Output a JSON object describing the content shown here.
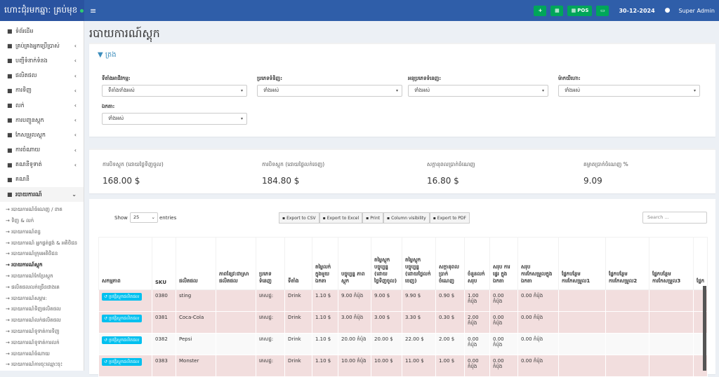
{
  "brand": {
    "title": "ហោះជុំរមកឆ្នា: គ្រប់មុខ"
  },
  "topbar": {
    "calc_icon": "calculator-icon",
    "pos_label": "POS",
    "date": "30-12-2024",
    "user": "Super Admin"
  },
  "sidebar": {
    "items": [
      {
        "label": "ទំព័រដើម",
        "icon": "dashboard-icon",
        "chev": ""
      },
      {
        "label": "គ្រប់គ្រងអ្នកប្រើប្រាស់",
        "icon": "users-icon",
        "chev": "‹"
      },
      {
        "label": "បញ្ជីទំនាក់ទំនង",
        "icon": "contacts-icon",
        "chev": "‹"
      },
      {
        "label": "ផលិតផល",
        "icon": "cubes-icon",
        "chev": "‹"
      },
      {
        "label": "ការទិញ",
        "icon": "purchase-icon",
        "chev": "‹"
      },
      {
        "label": "លក់",
        "icon": "sell-icon",
        "chev": "‹"
      },
      {
        "label": "ការបញ្ជូនស្តុក",
        "icon": "truck-icon",
        "chev": "‹"
      },
      {
        "label": "កែសម្រួលស្តុក",
        "icon": "database-icon",
        "chev": "‹"
      },
      {
        "label": "ការចំណាយ",
        "icon": "minus-circle-icon",
        "chev": "‹"
      },
      {
        "label": "គណនីទូទាត់",
        "icon": "money-icon",
        "chev": "‹"
      },
      {
        "label": "គណនី",
        "icon": "card-icon",
        "chev": ""
      },
      {
        "label": "របាយការណ៍",
        "icon": "chart-icon",
        "chev": "⌄"
      }
    ],
    "subitems": [
      "→ របាយការណ៍ចំណេញ / ខាត",
      "→ ទិញ & លក់",
      "→ របាយការណ៍ពន្ធ",
      "→ របាយការណ៍ អ្នកផ្គត់ផ្គង់ & អតិថិជន",
      "→ របាយការណ៍ក្រុមអតិថិជន",
      "→ របាយការណ៍ស្តុក",
      "→ របាយការណ៍កែប្រែស្តុក",
      "→ ផលិតផលលក់ច្រើនជាងគេ",
      "→ របាយការណ៍សម្ភារ:",
      "→ របាយការណ៍ទិញផលិតផល",
      "→ របាយការណ៍លក់ផលិតផល",
      "→ របាយការណ៍ទូទាត់ការទិញ",
      "→ របាយការណ៍ទូទាត់ការលក់",
      "→ របាយការណ៍ចំណាយ",
      "→ របាយការណ៍ការចុះឈ្មោះចុះ"
    ]
  },
  "page": {
    "title": "របាយការណ៍ស្តុក"
  },
  "filters": {
    "heading": "ត្រង",
    "fields": [
      {
        "label": "ទីតាំងអាជីវកម្ម:",
        "value": "ទីតាំងទាំងអស់"
      },
      {
        "label": "ប្រភេទទំនិញ:",
        "value": "ទាំងអស់"
      },
      {
        "label": "អនុប្រភេទទំនេញ:",
        "value": "ទាំងអស់"
      },
      {
        "label": "ម៉ាកយីហោ:",
        "value": "ទាំងអស់"
      },
      {
        "label": "ឯកតា:",
        "value": "ទាំងអស់"
      }
    ]
  },
  "summary": [
    {
      "label": "ការបិទស្តុក (ដោយថ្លៃទិញចូល)",
      "value": "168.00 $"
    },
    {
      "label": "ការបិទស្តុក (ដោយថ្លៃលក់ចេញ)",
      "value": "184.80 $"
    },
    {
      "label": "សក្តានុពលប្រាក់ចំណេញ",
      "value": "16.80 $"
    },
    {
      "label": "គម្លាតប្រាក់ចំណេញ %",
      "value": "9.09"
    }
  ],
  "table_controls": {
    "show": "Show",
    "length": "25",
    "entries": "entries",
    "search_placeholder": "Search ...",
    "buttons": [
      "Export to CSV",
      "Export to Excel",
      "Print",
      "Column visibility",
      "Export to PDF"
    ]
  },
  "table": {
    "headers": [
      "សកម្មភាព",
      "SKU",
      "ផលិតផល",
      "ភាពខ្សែវ:ជាស្រា ផលិតផល",
      "ប្រភេទ ទំនេញ",
      "ទីតាំង",
      "តម្លៃលក់ក្នុងមួយឯកតា",
      "បច្ចុប្បន្ន ភាពស្តុក",
      "តម្លៃស្តុក បច្ចុប្បន្ន (ដោយថ្លៃទិញចូល)",
      "តម្លៃស្តុក បច្ចុប្បន្ន (ដោយថ្លៃលក់ចេញ)",
      "សក្តានុពល ប្រាក់ចំណេញ",
      "ចំនួនលក់ សរុប",
      "សរុប ការផ្ទេរ ក្នុងឯកតា",
      "សរុប ការកែសម្រួលក្នុងឯកតា",
      "ផ្នែកបន្ថែម ការកែសម្រួល1",
      "ផ្នែកបន្ថែម ការកែសម្រួល2",
      "ផ្នែកបន្ថែម ការកែសម្រួល3",
      "ផ្នែក"
    ],
    "action_label": "ប្រវត្តិស្តុកផលិតផល",
    "rows": [
      [
        "0380",
        "sting",
        "",
        "ភេសជ្ជ:",
        "Drink",
        "1.10 $",
        "9.00 កំប៉ុង",
        "9.00 $",
        "9.90 $",
        "0.90 $",
        "1.00 កំប៉ុង",
        "0.00 កំប៉ុង",
        "0.00 កំប៉ុង"
      ],
      [
        "0381",
        "Coca-Cola",
        "",
        "ភេសជ្ជ:",
        "Drink",
        "1.10 $",
        "3.00 កំប៉ុង",
        "3.00 $",
        "3.30 $",
        "0.30 $",
        "2.00 កំប៉ុង",
        "0.00 កំប៉ុង",
        "0.00 កំប៉ុង"
      ],
      [
        "0382",
        "Pepsi",
        "",
        "ភេសជ្ជ:",
        "Drink",
        "1.10 $",
        "20.00 កំប៉ុង",
        "20.00 $",
        "22.00 $",
        "2.00 $",
        "0.00 កំប៉ុង",
        "0.00 កំប៉ុង",
        "0.00 កំប៉ុង"
      ],
      [
        "0383",
        "Monster",
        "",
        "ភេសជ្ជ:",
        "Drink",
        "1.10 $",
        "10.00 កំប៉ុង",
        "10.00 $",
        "11.00 $",
        "1.00 $",
        "0.00 កំប៉ុង",
        "0.00 កំប៉ុង",
        "0.00 កំប៉ុង"
      ]
    ]
  }
}
